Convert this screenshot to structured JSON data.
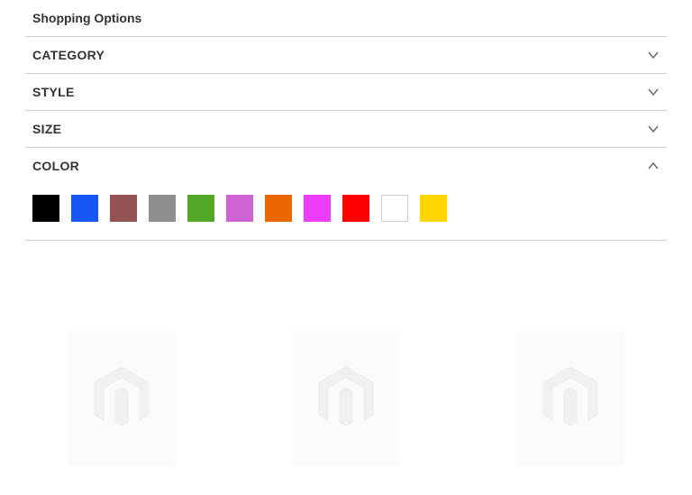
{
  "title": "Shopping Options",
  "filters": [
    {
      "key": "category",
      "label": "CATEGORY",
      "expanded": false
    },
    {
      "key": "style",
      "label": "STYLE",
      "expanded": false
    },
    {
      "key": "size",
      "label": "SIZE",
      "expanded": false
    },
    {
      "key": "color",
      "label": "COLOR",
      "expanded": true
    }
  ],
  "colorSwatches": [
    {
      "name": "black",
      "hex": "#000000"
    },
    {
      "name": "blue",
      "hex": "#1857f7"
    },
    {
      "name": "brown",
      "hex": "#945454"
    },
    {
      "name": "gray",
      "hex": "#8f8f8f"
    },
    {
      "name": "green",
      "hex": "#53a828"
    },
    {
      "name": "purple",
      "hex": "#ce64d4"
    },
    {
      "name": "orange",
      "hex": "#eb6703"
    },
    {
      "name": "magenta",
      "hex": "#ef3dff"
    },
    {
      "name": "red",
      "hex": "#ff0000"
    },
    {
      "name": "white",
      "hex": "#ffffff"
    },
    {
      "name": "yellow",
      "hex": "#ffd500"
    }
  ]
}
